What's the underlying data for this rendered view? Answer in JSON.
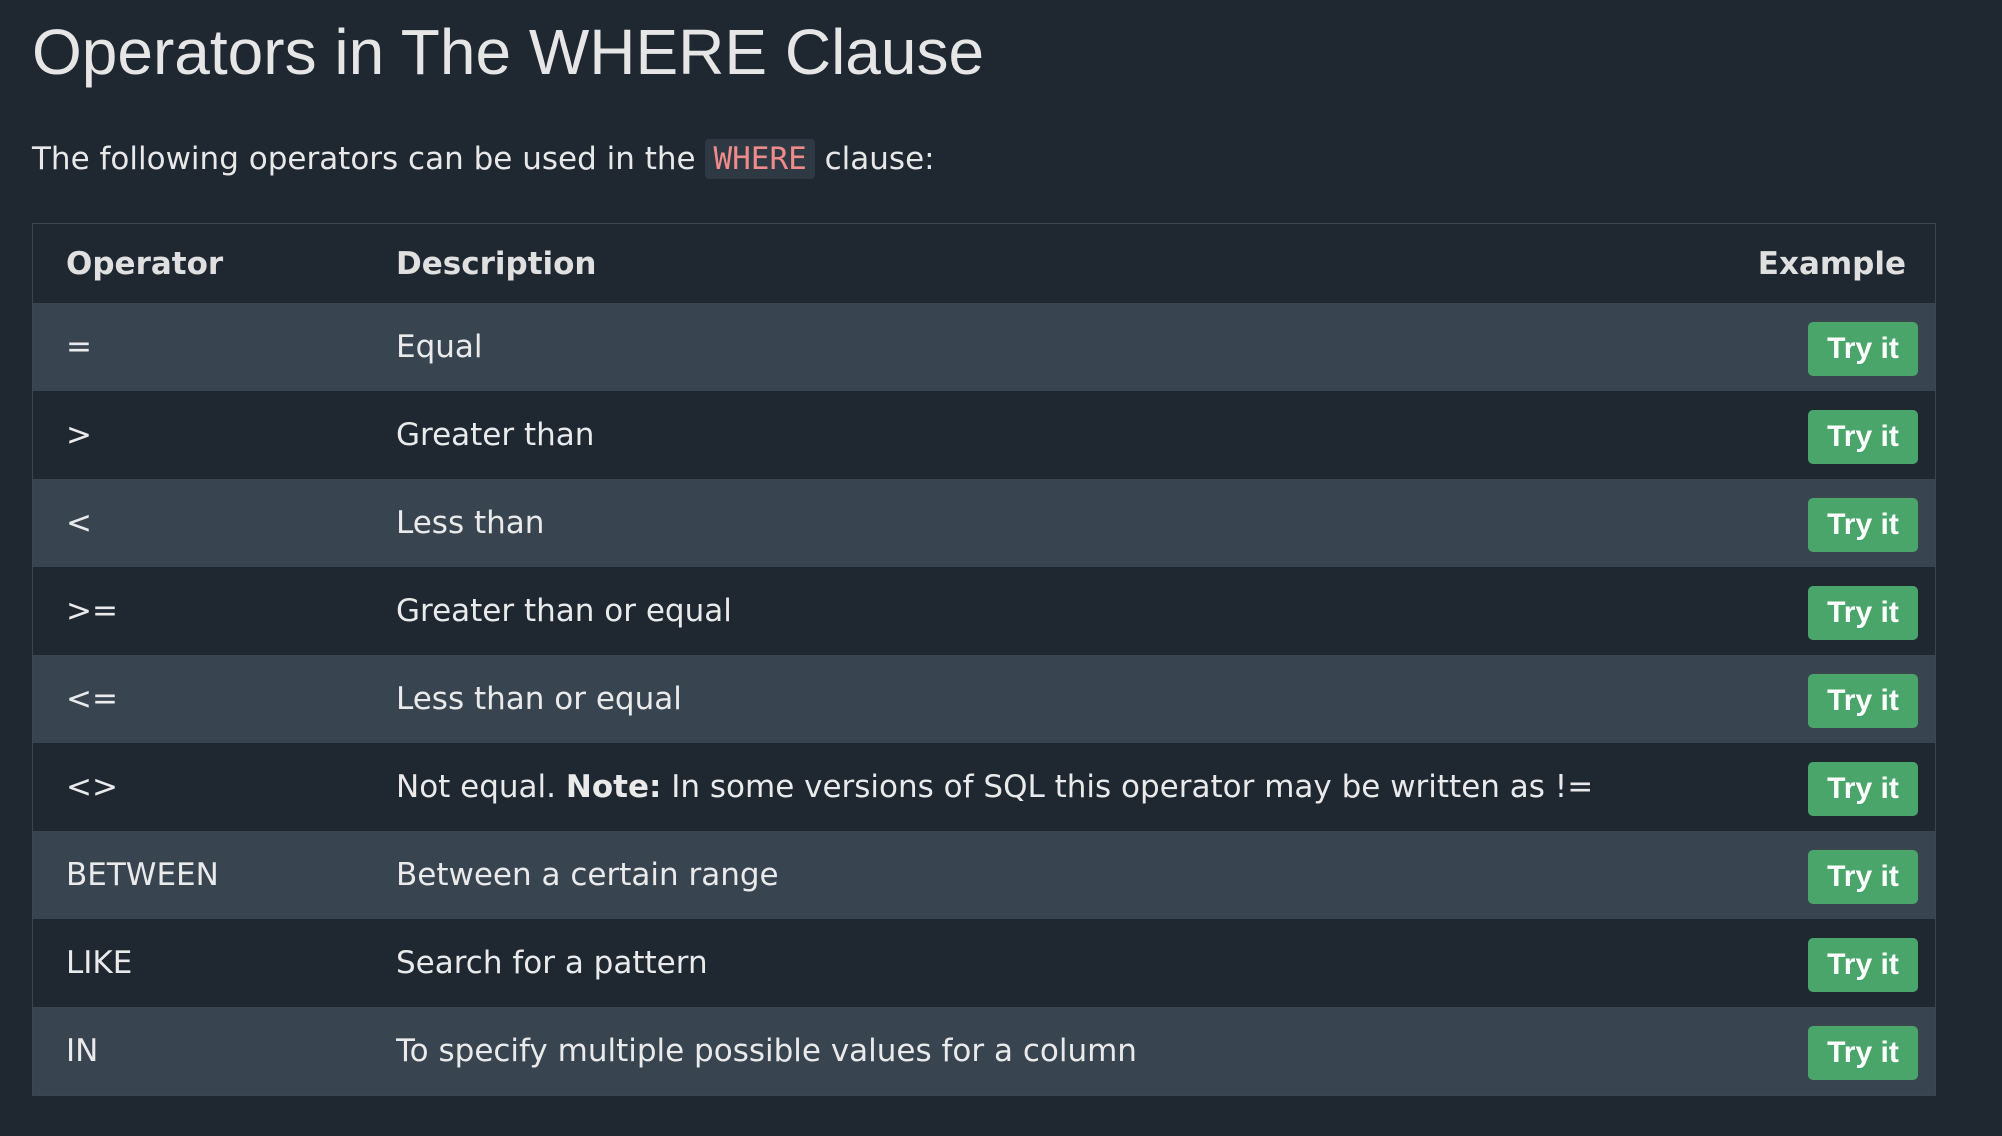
{
  "page": {
    "title": "Operators in The WHERE Clause",
    "intro_before": "The following operators can be used in the ",
    "intro_code": "WHERE",
    "intro_after": " clause:"
  },
  "table": {
    "headers": {
      "operator": "Operator",
      "description": "Description",
      "example": "Example"
    },
    "rows": [
      {
        "operator": "=",
        "description": "Equal",
        "button": "Try it"
      },
      {
        "operator": ">",
        "description": "Greater than",
        "button": "Try it"
      },
      {
        "operator": "<",
        "description": "Less than",
        "button": "Try it"
      },
      {
        "operator": ">=",
        "description": "Greater than or equal",
        "button": "Try it"
      },
      {
        "operator": "<=",
        "description": "Less than or equal",
        "button": "Try it"
      },
      {
        "operator": "<>",
        "description": "Not equal. ",
        "note_label": "Note:",
        "note_text": " In some versions of SQL this operator may be written as !=",
        "button": "Try it"
      },
      {
        "operator": "BETWEEN",
        "description": "Between a certain range",
        "button": "Try it"
      },
      {
        "operator": "LIKE",
        "description": "Search for a pattern",
        "button": "Try it"
      },
      {
        "operator": "IN",
        "description": "To specify multiple possible values for a column",
        "button": "Try it"
      }
    ]
  },
  "colors": {
    "background": "#1f2731",
    "row_alt": "#38444f",
    "button": "#4aa56a",
    "code_text": "#f08b8b"
  }
}
